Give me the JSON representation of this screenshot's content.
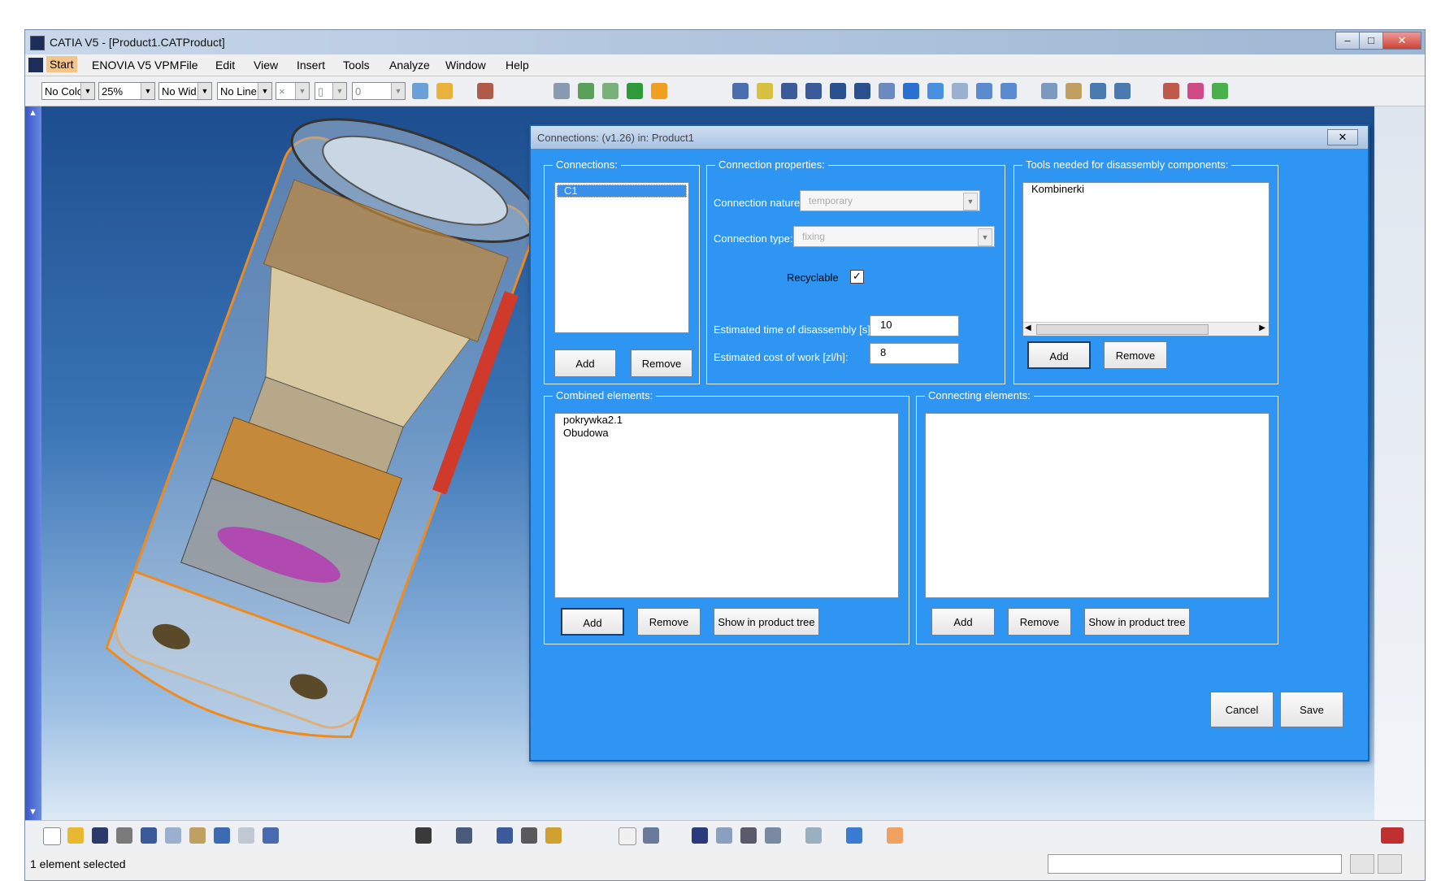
{
  "window": {
    "title": "CATIA V5 - [Product1.CATProduct]",
    "controls": [
      "–",
      "□",
      "✕"
    ]
  },
  "menu": [
    "Start",
    "ENOVIA V5 VPM",
    "File",
    "Edit",
    "View",
    "Insert",
    "Tools",
    "Analyze",
    "Window",
    "Help"
  ],
  "toolbar_top": {
    "color": "No Colo",
    "transparency": "25%",
    "linewidth": "No Wid",
    "linetype": "No Line",
    "layer": "0"
  },
  "status": {
    "text": "1 element selected"
  },
  "dialog": {
    "title": "Connections: (v1.26) in: Product1",
    "close_label": "✕",
    "connections": {
      "label": "Connections:",
      "items": [
        "C1"
      ],
      "add": "Add",
      "remove": "Remove"
    },
    "properties": {
      "label": "Connection properties:",
      "nature_label": "Connection nature:",
      "nature_value": "temporary",
      "type_label": "Connection type:",
      "type_value": "fixing",
      "recyclable_label": "Recyclable",
      "recyclable_checked": "✓",
      "time_label": "Estimated time of disassembly [s]:",
      "time_value": "10",
      "cost_label": "Estimated cost of work [zl/h]:",
      "cost_value": "8"
    },
    "tools": {
      "label": "Tools needed for disassembly components:",
      "items": [
        "Kombinerki"
      ],
      "add": "Add",
      "remove": "Remove"
    },
    "combined": {
      "label": "Combined elements:",
      "items": [
        "pokrywka2.1",
        "Obudowa"
      ],
      "add": "Add",
      "remove": "Remove",
      "show": "Show in product tree"
    },
    "connecting": {
      "label": "Connecting elements:",
      "items": [],
      "add": "Add",
      "remove": "Remove",
      "show": "Show in product tree"
    },
    "cancel": "Cancel",
    "save": "Save"
  },
  "colors": {
    "dialog_bg": "#2e96f2",
    "model_orange": "#f08a1c",
    "model_tan": "#c9b58a"
  }
}
